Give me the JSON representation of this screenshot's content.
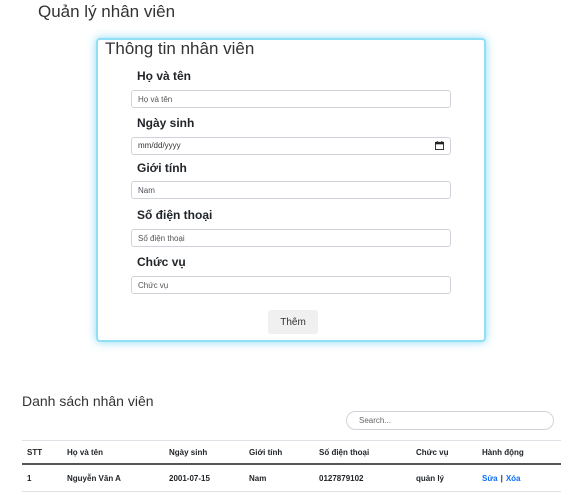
{
  "page": {
    "title": "Quản lý nhân viên"
  },
  "form": {
    "title": "Thông tin nhân viên",
    "fields": [
      {
        "label": "Họ và tên",
        "placeholder": "Họ và tên",
        "value": ""
      },
      {
        "label": "Ngày sinh",
        "placeholder": "",
        "value": "mm/dd/yyyy"
      },
      {
        "label": "Giới tính",
        "placeholder": "",
        "value": "Nam"
      },
      {
        "label": "Số điện thoại",
        "placeholder": "Số điện thoại",
        "value": ""
      },
      {
        "label": "Chức vụ",
        "placeholder": "Chức vụ",
        "value": ""
      }
    ],
    "submit_label": "Thêm"
  },
  "list": {
    "title": "Danh sách nhân viên",
    "search_placeholder": "Search...",
    "columns": [
      "STT",
      "Họ và tên",
      "Ngày sinh",
      "Giới tính",
      "Số điện thoại",
      "Chức vụ",
      "Hành động"
    ],
    "rows": [
      {
        "stt": "1",
        "name": "Nguyễn Văn A",
        "dob": "2001-07-15",
        "gender": "Nam",
        "phone": "0127879102",
        "position": "quản lý",
        "edit_label": "Sửa",
        "separator": "|",
        "delete_label": "Xóa"
      }
    ]
  },
  "icons": {
    "date_picker": "calendar-icon"
  }
}
